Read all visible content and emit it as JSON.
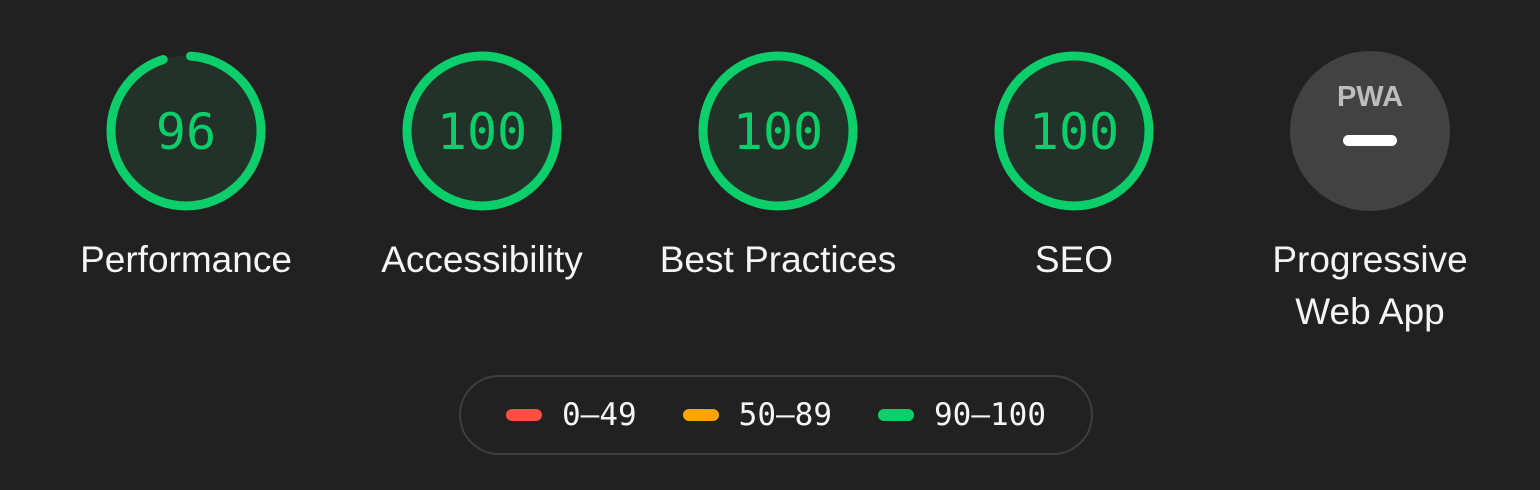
{
  "colors": {
    "background": "#212121",
    "pass": "#0cce6b",
    "average": "#ffa400",
    "fail": "#ff4e42",
    "pass_fill": "#233228",
    "pwa_fill": "#424242",
    "pwa_logo": "#bdbdbd"
  },
  "gauges": [
    {
      "label": "Performance",
      "score": "96",
      "value": 96,
      "status": "pass"
    },
    {
      "label": "Accessibility",
      "score": "100",
      "value": 100,
      "status": "pass"
    },
    {
      "label": "Best Practices",
      "score": "100",
      "value": 100,
      "status": "pass"
    },
    {
      "label": "SEO",
      "score": "100",
      "value": 100,
      "status": "pass"
    }
  ],
  "pwa": {
    "label_line1": "Progressive",
    "label_line2": "Web App",
    "badge_text": "PWA",
    "icon": "pwa-badge-icon"
  },
  "legend": {
    "items": [
      {
        "range": "0–49",
        "status": "fail"
      },
      {
        "range": "50–89",
        "status": "average"
      },
      {
        "range": "90–100",
        "status": "pass"
      }
    ]
  }
}
